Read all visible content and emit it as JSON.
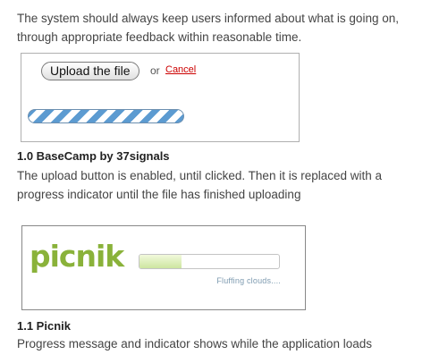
{
  "intro": {
    "line1": "The system should always keep users informed about what is going on,",
    "line2": "through appropriate feedback within reasonable time."
  },
  "basecamp": {
    "upload_label": "Upload the file",
    "or_text": "or",
    "cancel_label": "Cancel",
    "progress_style": "striped-indeterminate",
    "bar_color": "#5c9bd1",
    "heading": "1.0 BaseCamp by 37signals",
    "desc_line1": "The upload button is enabled, until clicked. Then it is replaced with a",
    "desc_line2": "progress indicator until the file has finished uploading"
  },
  "picnik": {
    "logo_text": "picnik",
    "logo_color": "#8ab23a",
    "progress_fraction": 0.3,
    "loading_message": "Fluffing clouds....",
    "heading": "1.1 Picnik",
    "description": "Progress message and indicator shows while the application loads"
  }
}
